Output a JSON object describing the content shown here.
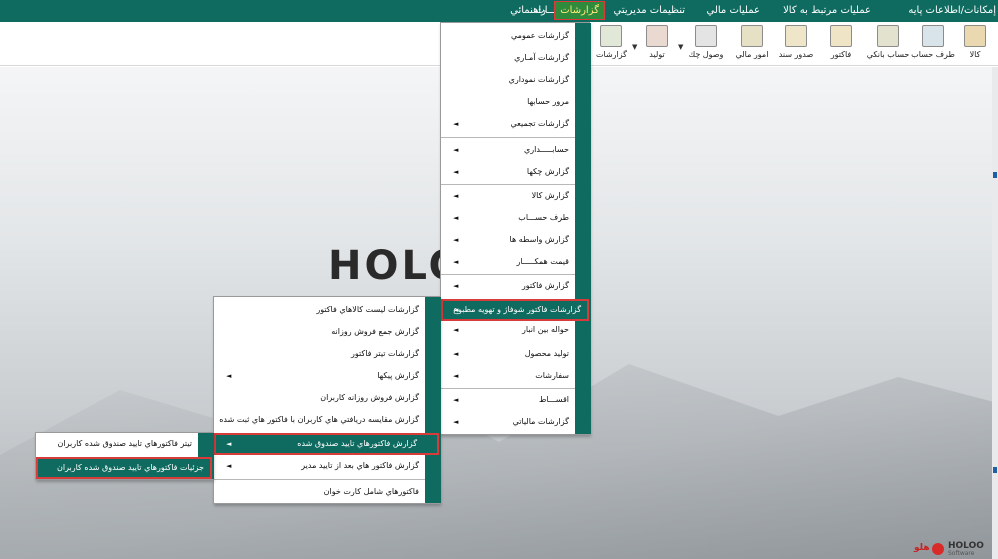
{
  "menubar": {
    "items": [
      {
        "label": "إمكانات/اطلاعات پايه"
      },
      {
        "label": "عمليات مرتبط به كالا"
      },
      {
        "label": "عمليات مالي"
      },
      {
        "label": "تنظيمات مديريتي"
      },
      {
        "label": "اصلاحـــات"
      },
      {
        "label": "گزارشات"
      },
      {
        "label": "راهنمائي"
      }
    ]
  },
  "toolbar": {
    "buttons": [
      {
        "label": "كالا",
        "icon": "box-icon"
      },
      {
        "label": "طرف حساب",
        "icon": "user-icon"
      },
      {
        "label": "حساب بانكي",
        "icon": "bank-icon"
      },
      {
        "label": "فاكتور",
        "icon": "invoice-icon"
      },
      {
        "label": "صدور سند",
        "icon": "document-icon"
      },
      {
        "label": "امور مالي",
        "icon": "finance-icon"
      },
      {
        "label": "وصول چك",
        "icon": "envelope-icon"
      },
      {
        "label": "توليد",
        "icon": "production-icon"
      },
      {
        "label": "گزارشات",
        "icon": "report-icon"
      }
    ]
  },
  "logo": {
    "text": "HOLO",
    "brand_en": "HOLOO",
    "brand_sub": "Software",
    "brand_fa": "هلو"
  },
  "reports_menu": {
    "items": [
      {
        "label": "گزارشات عمومي",
        "submenu": false
      },
      {
        "label": "گزارشات آمـاري",
        "submenu": false
      },
      {
        "label": "گزارشات نموداري",
        "submenu": false
      },
      {
        "label": "مرور حسابها",
        "submenu": false
      },
      {
        "label": "گزارشات تجميعي",
        "submenu": true
      },
      {
        "label": "حسابـــــداري",
        "submenu": true
      },
      {
        "label": "گزارش چكها",
        "submenu": true
      },
      {
        "label": "گزارش كالا",
        "submenu": true
      },
      {
        "label": "طرف حســـاب",
        "submenu": true
      },
      {
        "label": "گزارش واسطه ها",
        "submenu": true
      },
      {
        "label": "قيمت همكـــــار",
        "submenu": true
      },
      {
        "label": "گزارش فاكتور",
        "submenu": true
      },
      {
        "label": "گزارشات فاكتور شوفاژ و تهويه مطبوع",
        "submenu": true
      },
      {
        "label": "حواله بين انبار",
        "submenu": true
      },
      {
        "label": "توليد محصول",
        "submenu": true
      },
      {
        "label": "سفارشات",
        "submenu": true
      },
      {
        "label": "اقســـاط",
        "submenu": true
      },
      {
        "label": "گزارشات مالياتي",
        "submenu": true
      }
    ]
  },
  "invoice_submenu": {
    "items": [
      {
        "label": "گزارشات ليست كالاهاي فاكتور",
        "submenu": false
      },
      {
        "label": "گزارش جمع فروش روزانه",
        "submenu": false
      },
      {
        "label": "گزارشات تيتر فاكتور",
        "submenu": false
      },
      {
        "label": "گزارش پيكها",
        "submenu": true
      },
      {
        "label": "گزارش فروش روزانه كاربران",
        "submenu": false
      },
      {
        "label": "گزارش مقايسه دريافتي هاي  كاربران با فاكتور هاي ثبت شده",
        "submenu": false
      },
      {
        "label": "گزارش فاكتورهاي تاييد صندوق شده",
        "submenu": true
      },
      {
        "label": "گزارش فاكتور هاي بعد از تاييد مدير",
        "submenu": true
      },
      {
        "label": "فاكتورهاي شامل كارت خوان",
        "submenu": false
      }
    ]
  },
  "cashbox_submenu": {
    "items": [
      {
        "label": "تيتر فاكتورهاي تاييد صندوق شده كاربران"
      },
      {
        "label": "جزئيات فاكتورهاي تاييد صندوق شده كاربران"
      }
    ]
  },
  "colors": {
    "primary": "#0f6b60",
    "active_menu": "#2f8a3b",
    "highlight_border": "#d93a3a"
  }
}
